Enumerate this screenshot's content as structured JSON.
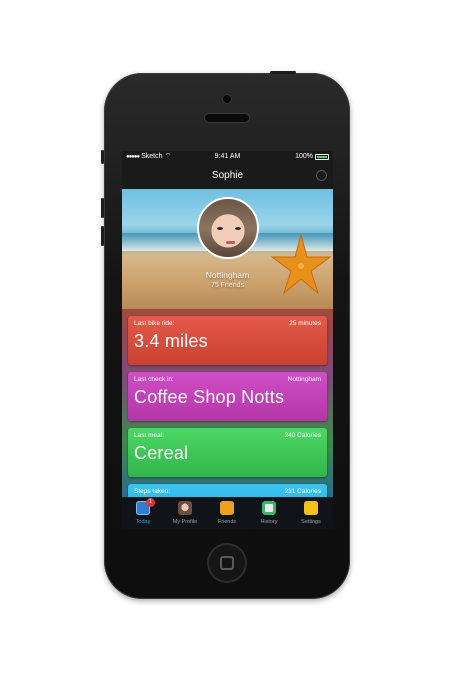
{
  "status_bar": {
    "carrier": "Sketch",
    "signal": "●●●●●",
    "time": "9:41 AM",
    "battery": "100%"
  },
  "nav": {
    "title": "Sophie"
  },
  "profile": {
    "location": "Nottingham",
    "friends": "75 Friends"
  },
  "cards": {
    "bike": {
      "label": "Last bike ride:",
      "meta": "25 minutes",
      "value": "3.4 miles",
      "color": "#d94c3a"
    },
    "check": {
      "label": "Last check in:",
      "meta": "Nottingham",
      "value": "Coffee Shop Notts",
      "color": "#c143b6"
    },
    "meal": {
      "label": "Last meal:",
      "meta": "240 Calories",
      "value": "Cereal",
      "color": "#3fc657"
    },
    "steps": {
      "label": "Steps taken:",
      "meta": "231 Calories",
      "value": "",
      "color": "#2eb4e6"
    }
  },
  "tabbar": {
    "today": {
      "label": "Today",
      "badge": "1",
      "icon": "calendar-icon",
      "active": true
    },
    "profile": {
      "label": "My Profile",
      "icon": "profile-photo-icon"
    },
    "friends": {
      "label": "Friends",
      "icon": "friends-icon"
    },
    "history": {
      "label": "History",
      "icon": "clock-icon"
    },
    "settings": {
      "label": "Settings",
      "icon": "gear-icon"
    }
  },
  "colors": {
    "accent": "#3aa0e8",
    "battery": "#4cd964",
    "badge": "#e8303a"
  }
}
